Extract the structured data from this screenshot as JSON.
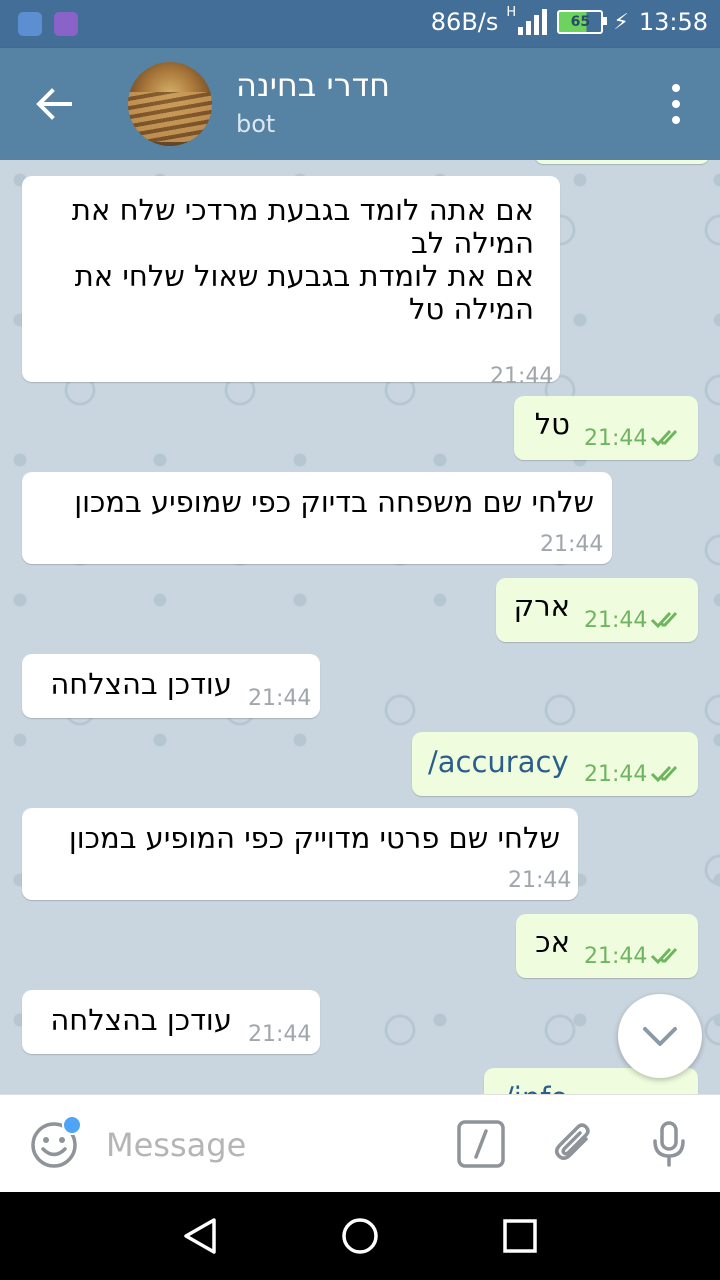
{
  "status_bar": {
    "network_speed": "86B/s",
    "network_type": "H",
    "battery": "65",
    "time": "13:58"
  },
  "header": {
    "title": "חדרי בחינה",
    "subtitle": "bot"
  },
  "messages": [
    {
      "direction": "in",
      "text": "אם אתה לומד בגבעת מרדכי שלח את המילה לב\nאם את לומדת בגבעת שאול שלחי את המילה טל",
      "time": "21:44"
    },
    {
      "direction": "out",
      "text": "טל",
      "time": "21:44"
    },
    {
      "direction": "in",
      "text": "שלחי שם משפחה בדיוק כפי שמופיע במכון",
      "time": "21:44"
    },
    {
      "direction": "out",
      "text": "ארק",
      "time": "21:44"
    },
    {
      "direction": "in",
      "text": "עודכן בהצלחה",
      "time": "21:44"
    },
    {
      "direction": "out",
      "text": "/accuracy",
      "time": "21:44"
    },
    {
      "direction": "in",
      "text": "שלחי שם פרטי מדוייק כפי המופיע במכון",
      "time": "21:44"
    },
    {
      "direction": "out",
      "text": "אכ",
      "time": "21:44"
    },
    {
      "direction": "in",
      "text": "עודכן בהצלחה",
      "time": "21:44"
    },
    {
      "direction": "out",
      "text": "/info",
      "time": ""
    }
  ],
  "input": {
    "placeholder": "Message"
  },
  "colors": {
    "header_bg": "#5682a3",
    "status_bar_bg": "#436e98",
    "outgoing_bubble": "#effdde",
    "incoming_bubble": "#ffffff",
    "read_check": "#6fb45e",
    "chat_bg": "#c9d6df",
    "notification_dot": "#4ea4f6"
  },
  "icons": [
    "back-arrow-icon",
    "more-vert-icon",
    "double-check-icon",
    "scroll-down-icon",
    "emoji-icon",
    "bot-command-icon",
    "attach-icon",
    "mic-icon",
    "nav-back-icon",
    "nav-home-icon",
    "nav-recents-icon"
  ]
}
